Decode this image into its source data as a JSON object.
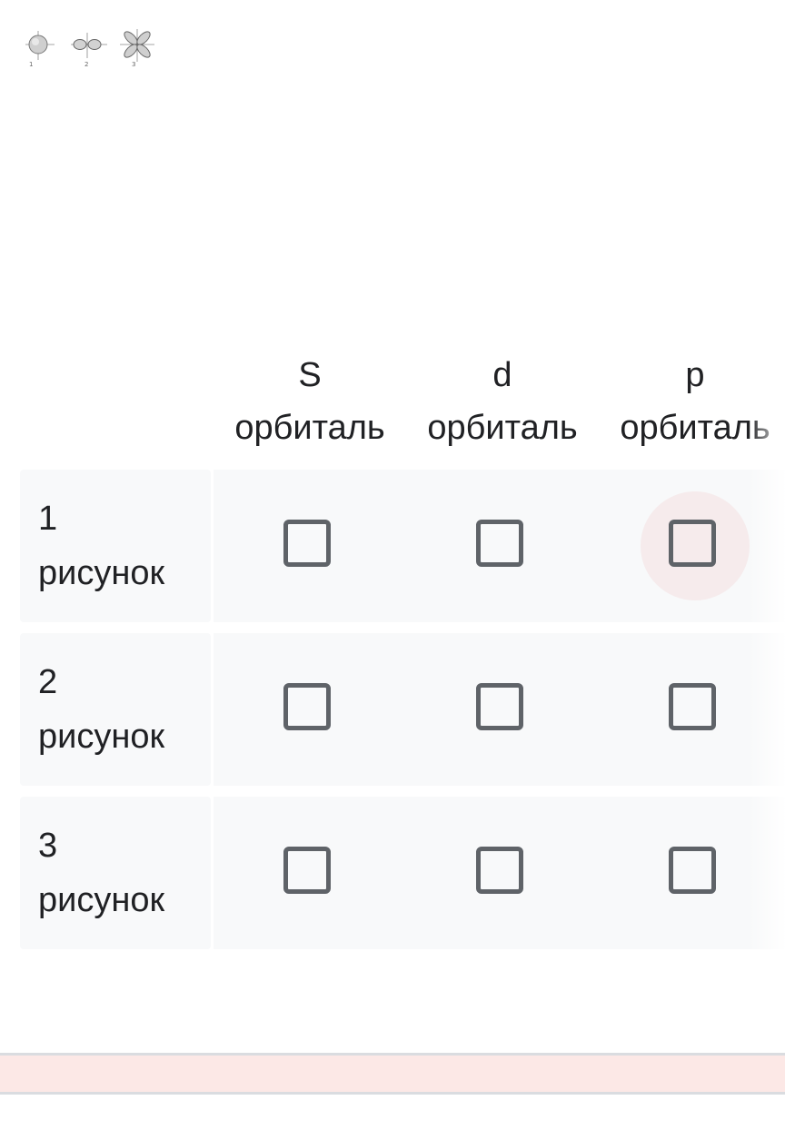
{
  "figure": {
    "numbers": [
      "1",
      "2",
      "3"
    ],
    "icons": [
      "s-orbital-icon",
      "p-orbital-icon",
      "d-orbital-icon"
    ]
  },
  "grid": {
    "columns": [
      {
        "letter": "S",
        "word": "орбиталь"
      },
      {
        "letter": "d",
        "word": "орбиталь"
      },
      {
        "letter": "p",
        "word": "орбиталь"
      }
    ],
    "rows": [
      {
        "number": "1",
        "word": "рисунок"
      },
      {
        "number": "2",
        "word": "рисунок"
      },
      {
        "number": "3",
        "word": "рисунок"
      }
    ]
  },
  "colors": {
    "cell_background": "#f8f9fa",
    "checkbox_border": "#5f6368",
    "banner_background": "#fce8e6"
  }
}
